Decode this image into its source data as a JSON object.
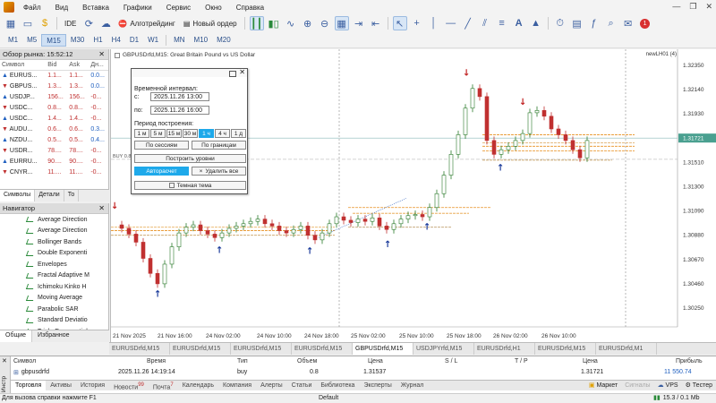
{
  "menu": [
    "Файл",
    "Вид",
    "Вставка",
    "Графики",
    "Сервис",
    "Окно",
    "Справка"
  ],
  "toolbar": {
    "algo_label": "Алготрейдинг",
    "new_order_label": "Новый ордер",
    "ide_label": "IDE",
    "notification_count": "1"
  },
  "timeframes": [
    "M1",
    "M5",
    "M15",
    "M30",
    "H1",
    "H4",
    "D1",
    "W1",
    "MN",
    "M10",
    "M20"
  ],
  "market_watch": {
    "title": "Обзор рынка: 15:52:12",
    "columns": [
      "Символ",
      "Bid",
      "Ask",
      "Дн..."
    ],
    "rows": [
      {
        "symbol": "EURUS...",
        "bid": "1.1...",
        "ask": "1.1...",
        "change": "0.0..."
      },
      {
        "symbol": "GBPUS...",
        "bid": "1.3...",
        "ask": "1.3...",
        "change": "0.0..."
      },
      {
        "symbol": "USDJP...",
        "bid": "156...",
        "ask": "156...",
        "change": "-0..."
      },
      {
        "symbol": "USDC...",
        "bid": "0.8...",
        "ask": "0.8...",
        "change": "-0..."
      },
      {
        "symbol": "USDC...",
        "bid": "1.4...",
        "ask": "1.4...",
        "change": "-0..."
      },
      {
        "symbol": "AUDU...",
        "bid": "0.6...",
        "ask": "0.6...",
        "change": "0.3..."
      },
      {
        "symbol": "NZDU...",
        "bid": "0.5...",
        "ask": "0.5...",
        "change": "0.4..."
      },
      {
        "symbol": "USDR...",
        "bid": "78....",
        "ask": "78....",
        "change": "-0..."
      },
      {
        "symbol": "EURRU...",
        "bid": "90....",
        "ask": "90....",
        "change": "-0..."
      },
      {
        "symbol": "CNYR...",
        "bid": "11....",
        "ask": "11....",
        "change": "-0..."
      }
    ],
    "tabs": [
      "Символы",
      "Детали",
      "То"
    ]
  },
  "navigator": {
    "title": "Навигатор",
    "items": [
      "Average Direction",
      "Average Direction",
      "Bollinger Bands",
      "Double Exponenti",
      "Envelopes",
      "Fractal Adaptive M",
      "Ichimoku Kinko H",
      "Moving Average",
      "Parabolic SAR",
      "Standard Deviatio",
      "Triple Exponential"
    ],
    "tabs": [
      "Общие",
      "Избранное"
    ]
  },
  "chart": {
    "title": "GBPUSDrfd,M15:  Great Britain Pound vs US Dollar",
    "ea_label": "newLH01 (4)",
    "buy_label": "BUY 0.8",
    "price_labels": [
      "1.32350",
      "1.32140",
      "1.31930",
      "1.31721",
      "1.31510",
      "1.31300",
      "1.31090",
      "1.30880",
      "1.30670",
      "1.30460",
      "1.30250"
    ],
    "current_price": "1.31721",
    "time_labels": [
      "21 Nov 2025",
      "21 Nov 16:00",
      "24 Nov 02:00",
      "24 Nov 10:00",
      "24 Nov 18:00",
      "25 Nov 02:00",
      "25 Nov 10:00",
      "25 Nov 18:00",
      "26 Nov 02:00",
      "26 Nov 10:00"
    ]
  },
  "dialog": {
    "interval_label": "Временной интервал:",
    "from_label": "с:",
    "from_value": "2025.11.26 13:00",
    "to_label": "по:",
    "to_value": "2025.11.26 16:00",
    "period_label": "Период построения:",
    "periods": [
      "1 м",
      "5 м",
      "15 м",
      "30 м",
      "1 ч",
      "4 ч",
      "1 д"
    ],
    "active_period": "1 ч",
    "by_sessions": "По сессиям",
    "by_bounds": "По границам",
    "build_levels": "Построить уровни",
    "autocalc": "Авторасчет",
    "delete_all": "Удалить все",
    "dark_theme": "Темная тема"
  },
  "symbol_tabs": [
    "EURUSDrfd,M15",
    "EURUSDrfd,M15",
    "EURUSDrfd,M15",
    "EURUSDrfd,M15",
    "GBPUSDrfd,M15",
    "USDJPYrfd,M15",
    "EURUSDrfd,H1",
    "EURUSDrfd,M15",
    "EURUSDrfd,M1"
  ],
  "active_symbol_tab": 4,
  "trade": {
    "headers": {
      "symbol": "Символ",
      "time": "Время",
      "type": "Тип",
      "volume": "Объем",
      "price": "Цена",
      "sl": "S / L",
      "tp": "T / P",
      "price2": "Цена",
      "profit": "Прибыль"
    },
    "row": {
      "symbol": "gbpusdrfd",
      "time": "2025.11.26 14:19:14",
      "type": "buy",
      "volume": "0.8",
      "price": "1.31537",
      "price2": "1.31721",
      "profit": "11 550.74"
    }
  },
  "toolbox_side_label": "Инстр",
  "toolbox_tabs": [
    {
      "label": "Торговля",
      "badge": ""
    },
    {
      "label": "Активы",
      "badge": ""
    },
    {
      "label": "История",
      "badge": ""
    },
    {
      "label": "Новости",
      "badge": "99"
    },
    {
      "label": "Почта",
      "badge": "7"
    },
    {
      "label": "Календарь",
      "badge": ""
    },
    {
      "label": "Компания",
      "badge": ""
    },
    {
      "label": "Алерты",
      "badge": ""
    },
    {
      "label": "Статьи",
      "badge": ""
    },
    {
      "label": "Библиотека",
      "badge": ""
    },
    {
      "label": "Эксперты",
      "badge": ""
    },
    {
      "label": "Журнал",
      "badge": ""
    }
  ],
  "toolbox_right": {
    "market": "Маркет",
    "signals": "Сигналы",
    "vps": "VPS",
    "tester": "Тестер"
  },
  "status": {
    "help": "Для вызова справки нажмите F1",
    "default": "Default",
    "traffic": "15.3 / 0.1 Mb"
  },
  "colors": {
    "bull": "#2a7a2a",
    "bear": "#c03030",
    "level_orange": "#e89020",
    "accent": "#1ea9ea",
    "current_line": "#7fb0b0"
  }
}
